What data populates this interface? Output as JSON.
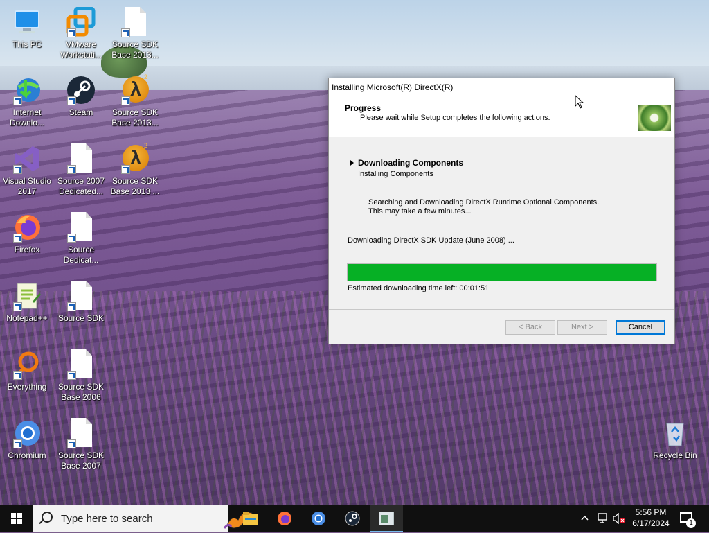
{
  "desktop": {
    "icons": [
      {
        "label": "This PC"
      },
      {
        "label": "VMware\nWorkstati..."
      },
      {
        "label": "Source SDK\nBase 2013..."
      },
      {
        "label": "Internet\nDownlo..."
      },
      {
        "label": "Steam"
      },
      {
        "label": "Source SDK\nBase 2013..."
      },
      {
        "label": "Visual Studio\n2017"
      },
      {
        "label": "Source 2007\nDedicated..."
      },
      {
        "label": "Source SDK\nBase 2013 ..."
      },
      {
        "label": "Firefox"
      },
      {
        "label": "Source\nDedicat..."
      },
      {
        "label": "Notepad++"
      },
      {
        "label": "Source SDK"
      },
      {
        "label": "Everything"
      },
      {
        "label": "Source SDK\nBase 2006"
      },
      {
        "label": "Chromium"
      },
      {
        "label": "Source SDK\nBase 2007"
      },
      {
        "label": "Recycle Bin"
      }
    ]
  },
  "dialog": {
    "title": "Installing Microsoft(R) DirectX(R)",
    "header_title": "Progress",
    "header_subtitle": "Please wait while Setup completes the following actions.",
    "current_step": "Downloading Components",
    "next_step": "Installing Components",
    "message_line1": "Searching and Downloading DirectX Runtime Optional Components.",
    "message_line2": "This may take a few minutes...",
    "download_status": "Downloading DirectX SDK Update (June 2008) ...",
    "progress_percent": 100,
    "eta": "Estimated downloading time left: 00:01:51",
    "back_label": "< Back",
    "next_label": "Next >",
    "cancel_label": "Cancel"
  },
  "taskbar": {
    "search_placeholder": "Type here to search",
    "time": "5:56 PM",
    "date": "6/17/2024",
    "notification_count": "1",
    "apps": [
      "file-explorer",
      "firefox",
      "chromium",
      "steam",
      "directx-setup"
    ]
  },
  "colors": {
    "progress_fill": "#06b025",
    "accent": "#0078d7",
    "taskbar": "#101010"
  }
}
